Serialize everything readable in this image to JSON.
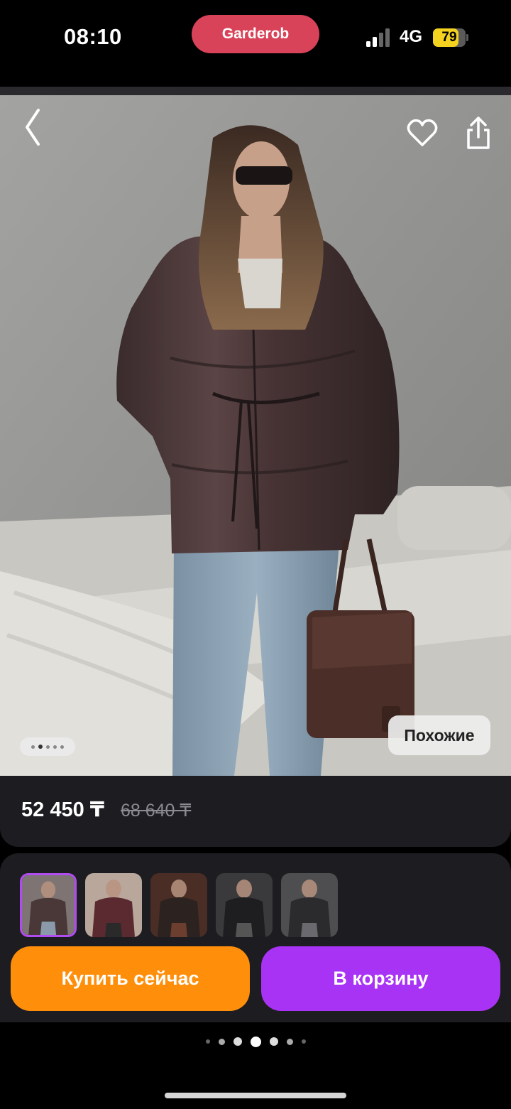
{
  "status_bar": {
    "time": "08:10",
    "app_name": "Garderob",
    "network": "4G",
    "battery_level": "79",
    "battery_fraction": 0.79,
    "signal_bars_active": 2
  },
  "product": {
    "similar_label": "Похожие",
    "image_count": 5,
    "current_image_index": 1
  },
  "price": {
    "current": "52 450 ₸",
    "old": "68 640 ₸"
  },
  "thumbnails": [
    {
      "name": "thumb-1",
      "active": true
    },
    {
      "name": "thumb-2",
      "active": false
    },
    {
      "name": "thumb-3",
      "active": false
    },
    {
      "name": "thumb-4",
      "active": false
    },
    {
      "name": "thumb-5",
      "active": false
    }
  ],
  "actions": {
    "buy_now": "Купить сейчас",
    "add_to_cart": "В корзину"
  },
  "pager": {
    "count": 7,
    "active_index": 3
  },
  "colors": {
    "accent_orange": "#ff8f0b",
    "accent_purple": "#a933f5",
    "app_pill": "#d9435a",
    "battery": "#f4d21f"
  }
}
